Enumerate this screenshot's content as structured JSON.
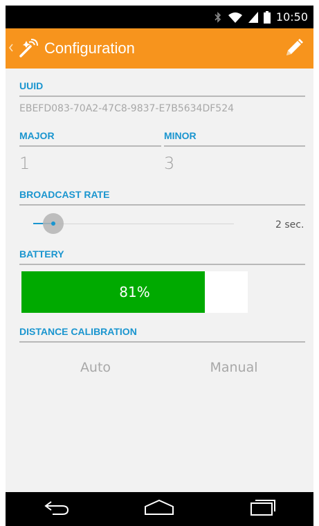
{
  "status_bar": {
    "time": "10:50",
    "icons": [
      "bluetooth-icon",
      "wifi-icon",
      "signal-icon",
      "battery-icon"
    ]
  },
  "action_bar": {
    "back_icon": "chevron-left-icon",
    "app_icon": "beacon-wand-icon",
    "title": "Configuration",
    "edit_icon": "pencil-icon",
    "background": "#f7941d"
  },
  "uuid": {
    "label": "UUID",
    "value": "EBEFD083-70A2-47C8-9837-E7B5634DF524"
  },
  "major": {
    "label": "MAJOR",
    "value": "1"
  },
  "minor": {
    "label": "MINOR",
    "value": "3"
  },
  "broadcast_rate": {
    "label": "BROADCAST RATE",
    "value_text": "2 sec.",
    "slider_fraction": 0.1
  },
  "battery": {
    "label": "BATTERY",
    "value_text": "81%",
    "percent": 81,
    "color": "#00aa00"
  },
  "distance_calibration": {
    "label": "DISTANCE CALIBRATION",
    "options": [
      "Auto",
      "Manual"
    ]
  },
  "nav_bar": {
    "icons": [
      "back-icon",
      "home-icon",
      "recent-apps-icon"
    ]
  },
  "colors": {
    "accent": "#1a95cf",
    "divider": "#b8b8b8"
  }
}
